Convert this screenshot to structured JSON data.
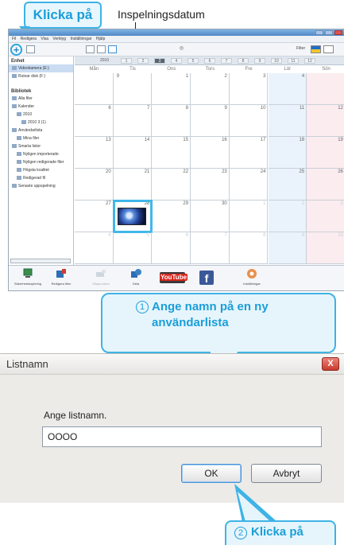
{
  "callouts": {
    "top": "Klicka på",
    "date_label": "Inspelningsdatum",
    "step1_num": "1",
    "step1_text": "Ange namn på en ny användarlista",
    "step2_num": "2",
    "step2_text": "Klicka på"
  },
  "app": {
    "menu": [
      "Fil",
      "Redigera",
      "Visa",
      "Verktyg",
      "Inställningar",
      "Hjälp"
    ],
    "toolbar": {
      "add": "+",
      "filter_label": "Filter"
    },
    "sidebar": {
      "device_heading": "Enhet",
      "device_items": [
        "Videokamera (E:)",
        "Rutvar disk (F:)"
      ],
      "library_heading": "Bibliotek",
      "library_items": [
        "Alla filer",
        "Kalender",
        "2010",
        "2010 3 (1)",
        "Användarlista",
        "Mina filer",
        "Smarta listor",
        "Nyligen importerade",
        "Nyligen redigerade filer",
        "Högsta kvalitet",
        "Redigerad fil",
        "Senaste uppspelning"
      ]
    },
    "calendar": {
      "year": "2010",
      "months": [
        "1",
        "2",
        "3",
        "4",
        "5",
        "6",
        "7",
        "8",
        "9",
        "10",
        "11",
        "12"
      ],
      "selected_month": "3",
      "weekdays": [
        "Mån",
        "Tis",
        "Ons",
        "Tors",
        "Fre",
        "Lör",
        "Sön"
      ],
      "weeks": [
        [
          "",
          "",
          "1",
          "2",
          "3",
          "4",
          ""
        ],
        [
          "6",
          "7",
          "8",
          "9",
          "10",
          "11",
          "12"
        ],
        [
          "13",
          "14",
          "15",
          "16",
          "17",
          "18",
          "19"
        ],
        [
          "20",
          "21",
          "22",
          "23",
          "24",
          "25",
          "26"
        ],
        [
          "27",
          "28",
          "29",
          "30",
          "1",
          "2",
          "3"
        ],
        [
          "4",
          "5",
          "6",
          "7",
          "8",
          "9",
          "10"
        ]
      ],
      "overlay_day": "9"
    },
    "bottom_buttons": [
      "Säkerhetskopiering",
      "Redigera filen",
      "Skapa skiva",
      "Dela",
      "YouTube",
      "Facebook",
      "Inställningar"
    ]
  },
  "dialog": {
    "title": "Listnamn",
    "close": "X",
    "prompt": "Ange listnamn.",
    "input_value": "OOOO",
    "ok": "OK",
    "cancel": "Avbryt"
  },
  "colors": {
    "accent": "#3eb3e6",
    "accent_text": "#1a9ed9"
  }
}
